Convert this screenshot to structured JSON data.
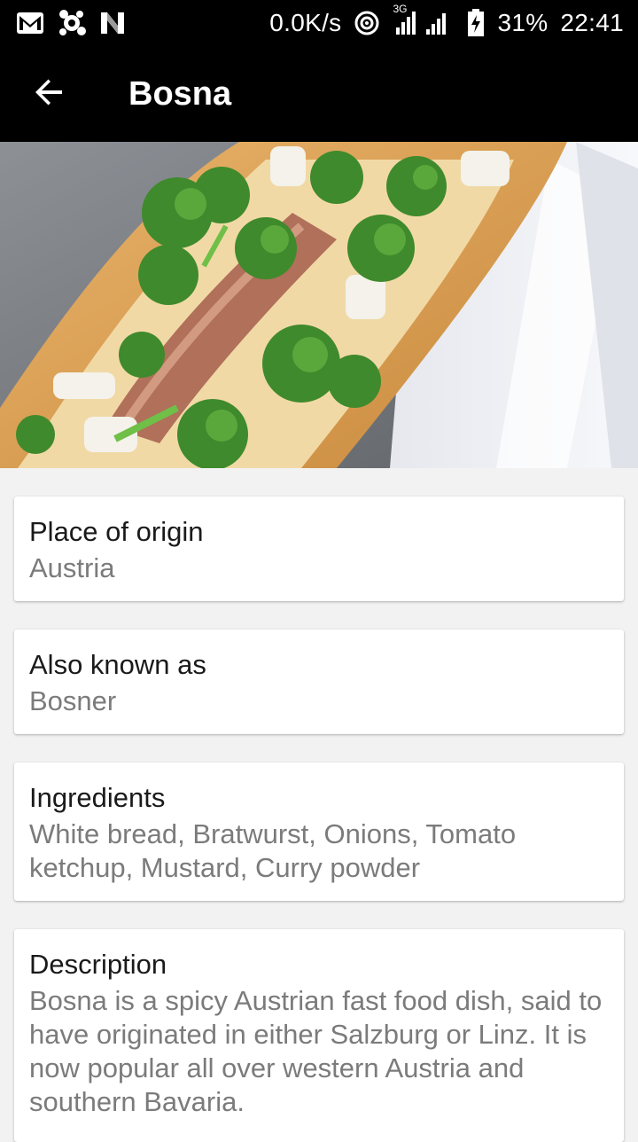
{
  "status_bar": {
    "left_icons": [
      "gmail-icon",
      "app-notification-icon",
      "n-app-icon"
    ],
    "network_speed": "0.0K/s",
    "network_type": "3G",
    "battery_percent": "31%",
    "time": "22:41"
  },
  "app_bar": {
    "back_icon": "arrow-left-icon",
    "title": "Bosna"
  },
  "hero": {
    "subject": "bosna-sandwich-photo"
  },
  "details": [
    {
      "label": "Place of origin",
      "value": "Austria"
    },
    {
      "label": "Also known as",
      "value": "Bosner"
    },
    {
      "label": "Ingredients",
      "value": "White bread, Bratwurst, Onions, Tomato ketchup, Mustard, Curry powder"
    },
    {
      "label": "Description",
      "value": "Bosna is a spicy Austrian fast food dish, said to have originated in either Salzburg or Linz. It is now popular all over western Austria and southern Bavaria."
    }
  ]
}
